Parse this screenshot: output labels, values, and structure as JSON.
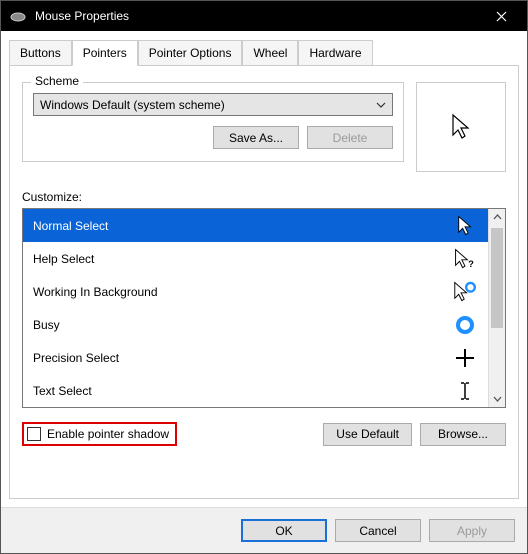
{
  "title": "Mouse Properties",
  "tabs": [
    "Buttons",
    "Pointers",
    "Pointer Options",
    "Wheel",
    "Hardware"
  ],
  "activeTab": 1,
  "scheme": {
    "legend": "Scheme",
    "value": "Windows Default (system scheme)",
    "saveAs": "Save As...",
    "delete": "Delete"
  },
  "customizeLabel": "Customize:",
  "cursors": [
    {
      "name": "Normal Select",
      "icon": "arrow",
      "selected": true
    },
    {
      "name": "Help Select",
      "icon": "arrow-q",
      "selected": false
    },
    {
      "name": "Working In Background",
      "icon": "arrow-ring",
      "selected": false
    },
    {
      "name": "Busy",
      "icon": "ring",
      "selected": false
    },
    {
      "name": "Precision Select",
      "icon": "cross",
      "selected": false
    },
    {
      "name": "Text Select",
      "icon": "ibeam",
      "selected": false
    }
  ],
  "enableShadow": {
    "label": "Enable pointer shadow",
    "checked": false
  },
  "useDefault": "Use Default",
  "browse": "Browse...",
  "ok": "OK",
  "cancel": "Cancel",
  "apply": "Apply"
}
